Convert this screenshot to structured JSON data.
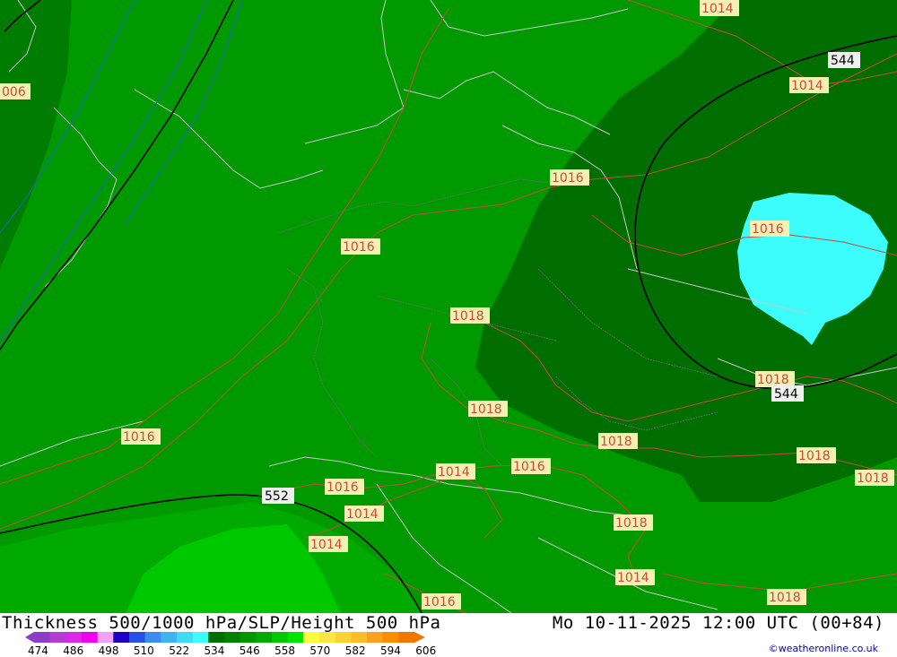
{
  "map": {
    "thickness_colors": {
      "t546": "#009a00",
      "t540": "#008800",
      "t534": "#006e00",
      "t552": "#00aa00",
      "t558": "#00c800",
      "cold_core": "#3cfcfc",
      "west_dark": "#007d00"
    },
    "isobar_color": "#c84b3c",
    "height_contour_color": "#000000",
    "isobar_labels": [
      {
        "id": "lbl-1014-top",
        "text": "1014"
      },
      {
        "id": "lbl-1014-ne",
        "text": "1014"
      },
      {
        "id": "lbl-1016-east",
        "text": "1016"
      },
      {
        "id": "lbl-1016-north",
        "text": "1016"
      },
      {
        "id": "lbl-1016-west",
        "text": "1016"
      },
      {
        "id": "lbl-1018-center",
        "text": "1018"
      },
      {
        "id": "lbl-1018-south",
        "text": "1018"
      },
      {
        "id": "lbl-1018-se",
        "text": "1018"
      },
      {
        "id": "lbl-1018-east",
        "text": "1018"
      },
      {
        "id": "lbl-1018-far-east",
        "text": "1018"
      },
      {
        "id": "lbl-1018-edge",
        "text": "1018"
      },
      {
        "id": "lbl-1016-sw",
        "text": "1016"
      },
      {
        "id": "lbl-1014-alps",
        "text": "1014"
      },
      {
        "id": "lbl-1016-alps",
        "text": "1016"
      },
      {
        "id": "lbl-1016-alps2",
        "text": "1016"
      },
      {
        "id": "lbl-1014-italy",
        "text": "1014"
      },
      {
        "id": "lbl-1014-italy2",
        "text": "1014"
      },
      {
        "id": "lbl-1018-balkan",
        "text": "1018"
      },
      {
        "id": "lbl-1014-adriatic",
        "text": "1014"
      },
      {
        "id": "lbl-1016-south",
        "text": "1016"
      },
      {
        "id": "lbl-1018-bottom",
        "text": "1018"
      },
      {
        "id": "lbl-006-left",
        "text": "006"
      }
    ],
    "height_labels": [
      {
        "id": "hlbl-544-top",
        "text": "544"
      },
      {
        "id": "hlbl-544-low",
        "text": "544"
      },
      {
        "id": "hlbl-552",
        "text": "552"
      }
    ]
  },
  "footer": {
    "title": "Thickness 500/1000 hPa/SLP/Height 500 hPa",
    "datetime": "Mo 10-11-2025 12:00 UTC (00+84)",
    "credit": "©weatheronline.co.uk"
  },
  "legend": {
    "ticks": [
      "474",
      "486",
      "498",
      "510",
      "522",
      "534",
      "546",
      "558",
      "570",
      "582",
      "594",
      "606"
    ],
    "colors": [
      "#8c3cc8",
      "#b43cd2",
      "#dc28e6",
      "#f000f0",
      "#f4a0f4",
      "#1e00c8",
      "#2850e6",
      "#3c8cf0",
      "#3cb4f0",
      "#3cdcf4",
      "#3cfcfc",
      "#006e00",
      "#008200",
      "#009600",
      "#00aa00",
      "#00c800",
      "#00e600",
      "#fcfc3c",
      "#fce646",
      "#fcd232",
      "#fcbe28",
      "#fca01e",
      "#fc8c00",
      "#f07800"
    ]
  }
}
